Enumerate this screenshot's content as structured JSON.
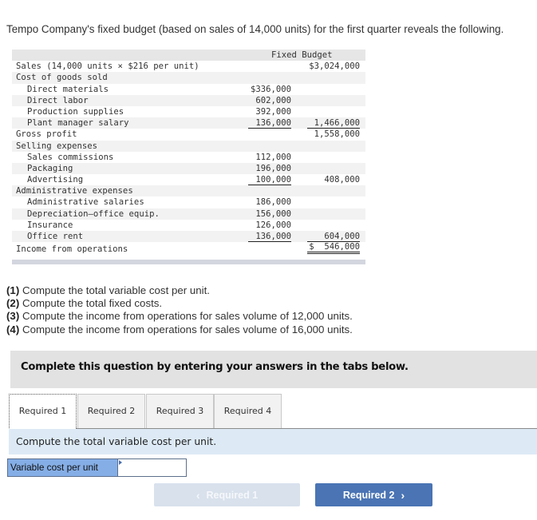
{
  "intro": "Tempo Company's fixed budget (based on sales of 14,000 units) for the first quarter reveals the following.",
  "budget": {
    "header": "Fixed Budget",
    "rows": [
      {
        "label": "Sales (14,000 units × $216 per unit)",
        "c1": "",
        "c2": "$3,024,000"
      },
      {
        "label": "Cost of goods sold",
        "c1": "",
        "c2": ""
      },
      {
        "label": "Direct materials",
        "c1": "$336,000",
        "c2": ""
      },
      {
        "label": "Direct labor",
        "c1": "602,000",
        "c2": ""
      },
      {
        "label": "Production supplies",
        "c1": "392,000",
        "c2": ""
      },
      {
        "label": "Plant manager salary",
        "c1": "136,000",
        "c2": "1,466,000"
      },
      {
        "label": "Gross profit",
        "c1": "",
        "c2": "1,558,000"
      },
      {
        "label": "Selling expenses",
        "c1": "",
        "c2": ""
      },
      {
        "label": "Sales commissions",
        "c1": "112,000",
        "c2": ""
      },
      {
        "label": "Packaging",
        "c1": "196,000",
        "c2": ""
      },
      {
        "label": "Advertising",
        "c1": "100,000",
        "c2": "408,000"
      },
      {
        "label": "Administrative expenses",
        "c1": "",
        "c2": ""
      },
      {
        "label": "Administrative salaries",
        "c1": "186,000",
        "c2": ""
      },
      {
        "label": "Depreciation—office equip.",
        "c1": "156,000",
        "c2": ""
      },
      {
        "label": "Insurance",
        "c1": "126,000",
        "c2": ""
      },
      {
        "label": "Office rent",
        "c1": "136,000",
        "c2": "604,000"
      },
      {
        "label": "Income from operations",
        "c1": "",
        "c2": "$  546,000"
      }
    ]
  },
  "requirements": [
    {
      "num": "(1)",
      "text": " Compute the total variable cost per unit."
    },
    {
      "num": "(2)",
      "text": " Compute the total fixed costs."
    },
    {
      "num": "(3)",
      "text": " Compute the income from operations for sales volume of 12,000 units."
    },
    {
      "num": "(4)",
      "text": " Compute the income from operations for sales volume of 16,000 units."
    }
  ],
  "banner": "Complete this question by entering your answers in the tabs below.",
  "tabs": [
    {
      "label": "Required 1",
      "active": true
    },
    {
      "label": "Required 2",
      "active": false
    },
    {
      "label": "Required 3",
      "active": false
    },
    {
      "label": "Required 4",
      "active": false
    }
  ],
  "panel": {
    "instruction": "Compute the total variable cost per unit.",
    "field_label": "Variable cost per unit",
    "field_value": ""
  },
  "nav": {
    "prev_label": "Required 1",
    "next_label": "Required 2",
    "prev_icon": "chevron-left-icon",
    "next_icon": "chevron-right-icon"
  }
}
